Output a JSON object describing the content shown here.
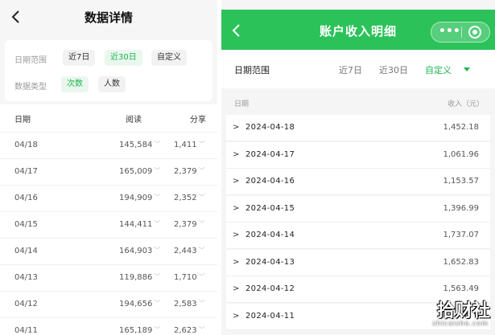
{
  "left": {
    "title": "数据详情",
    "filters": {
      "date_label": "日期范围",
      "date_options": [
        "近7日",
        "近30日",
        "自定义"
      ],
      "date_active": "近30日",
      "type_label": "数据类型",
      "type_options": [
        "次数",
        "人数"
      ],
      "type_active": "次数"
    },
    "columns": [
      "日期",
      "阅读",
      "分享"
    ],
    "rows": [
      {
        "date": "04/18",
        "read": "145,584",
        "share": "1,411"
      },
      {
        "date": "04/17",
        "read": "165,009",
        "share": "2,379"
      },
      {
        "date": "04/16",
        "read": "194,909",
        "share": "2,352"
      },
      {
        "date": "04/15",
        "read": "144,411",
        "share": "2,379"
      },
      {
        "date": "04/14",
        "read": "164,903",
        "share": "2,443"
      },
      {
        "date": "04/13",
        "read": "119,886",
        "share": "1,710"
      },
      {
        "date": "04/12",
        "read": "194,656",
        "share": "2,583"
      },
      {
        "date": "04/11",
        "read": "165,189",
        "share": "2,623"
      }
    ]
  },
  "right": {
    "title": "账户收入明细",
    "filters": {
      "label": "日期范围",
      "options": [
        "近7日",
        "近30日",
        "自定义"
      ],
      "active": "自定义"
    },
    "columns": {
      "date": "日期",
      "amount": "收入（元）"
    },
    "rows": [
      {
        "date": "2024-04-18",
        "amount": "1,452.18"
      },
      {
        "date": "2024-04-17",
        "amount": "1,061.96"
      },
      {
        "date": "2024-04-16",
        "amount": "1,153.57"
      },
      {
        "date": "2024-04-15",
        "amount": "1,396.99"
      },
      {
        "date": "2024-04-14",
        "amount": "1,737.07"
      },
      {
        "date": "2024-04-13",
        "amount": "1,652.83"
      },
      {
        "date": "2024-04-12",
        "amount": "1,563.49"
      },
      {
        "date": "2024-04-11",
        "amount": ""
      }
    ],
    "capsule": {
      "more_icon": "more-dots-icon",
      "close_icon": "target-close-icon"
    }
  },
  "watermark": {
    "main": "拾财社",
    "sub": "shicaishe.com"
  },
  "colors": {
    "accent": "#1fb552",
    "header_green": "#2cc25a"
  }
}
